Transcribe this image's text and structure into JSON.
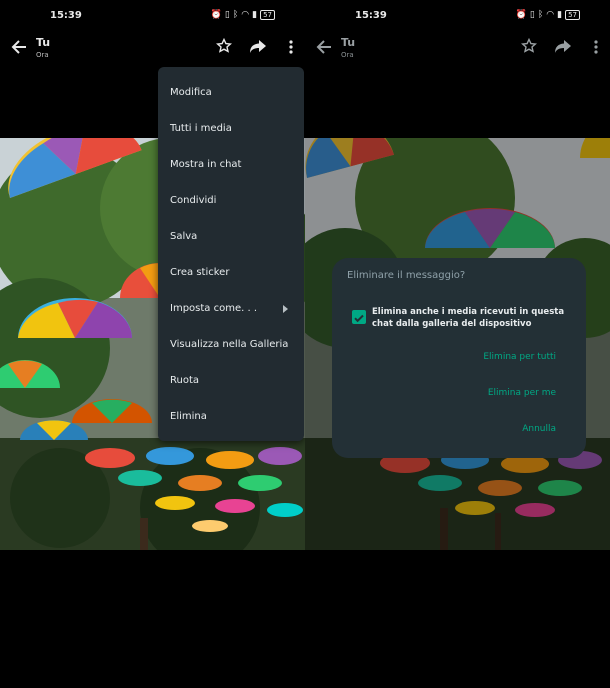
{
  "status_bar": {
    "time": "15:39",
    "battery": "57"
  },
  "chat": {
    "title": "Tu",
    "subtitle": "Ora"
  },
  "menu": {
    "items": [
      "Modifica",
      "Tutti i media",
      "Mostra in chat",
      "Condividi",
      "Salva",
      "Crea sticker",
      "Imposta come. . .",
      "Visualizza nella Galleria",
      "Ruota",
      "Elimina"
    ]
  },
  "dialog": {
    "title": "Eliminare il messaggio?",
    "checkbox_label": "Elimina anche i media ricevuti in questa chat dalla galleria del dispositivo",
    "checkbox_checked": true,
    "buttons": [
      "Elimina per tutti",
      "Elimina per me",
      "Annulla"
    ]
  },
  "colors": {
    "accent": "#00a884",
    "menu_bg": "#222b31",
    "dialog_bg": "#233036"
  }
}
